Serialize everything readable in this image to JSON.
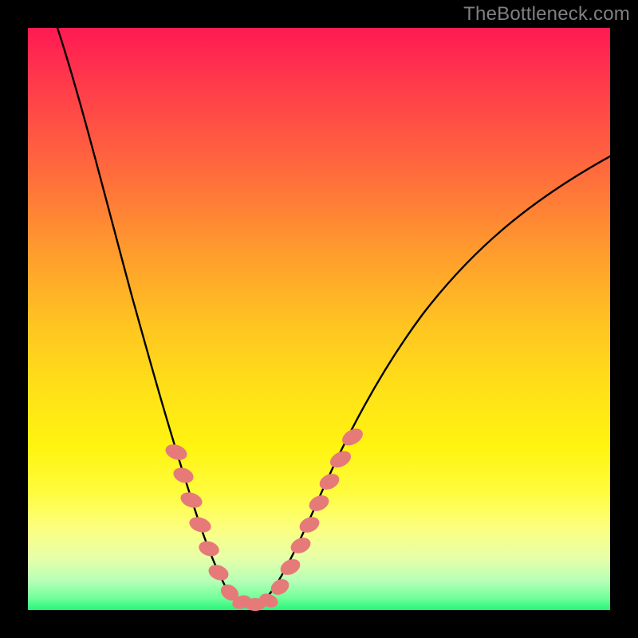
{
  "watermark": "TheBottleneck.com",
  "colors": {
    "background": "#000000",
    "curve_stroke": "#000000",
    "salmon_bead": "#e67a79",
    "salmon_bead_tint": "#f0908e",
    "watermark_text": "#808080"
  },
  "chart_data": {
    "type": "line",
    "title": "",
    "xlabel": "",
    "ylabel": "",
    "xlim": [
      0,
      100
    ],
    "ylim": [
      0,
      100
    ],
    "x": [
      4,
      6,
      8,
      10,
      12,
      14,
      16,
      18,
      20,
      22,
      24,
      26,
      28,
      30,
      32,
      34,
      36,
      38,
      40,
      44,
      48,
      52,
      56,
      60,
      64,
      68,
      72,
      76,
      80,
      84,
      88,
      92,
      96,
      100
    ],
    "y": [
      100,
      94,
      88,
      82,
      76,
      70,
      63,
      56,
      49,
      42,
      34,
      26,
      18,
      10,
      4,
      1,
      0,
      0,
      1,
      5,
      11,
      18,
      25,
      32,
      39,
      45,
      51,
      57,
      62,
      66,
      70,
      73,
      76,
      78
    ],
    "annotations": {
      "beads_left_arm": {
        "x_range": [
          23,
          32
        ],
        "y_range": [
          6,
          35
        ]
      },
      "beads_right_arm": {
        "x_range": [
          40,
          50
        ],
        "y_range": [
          2,
          35
        ]
      },
      "valley_floor": {
        "x_range": [
          33,
          39
        ],
        "y_range": [
          0,
          1
        ]
      }
    }
  }
}
